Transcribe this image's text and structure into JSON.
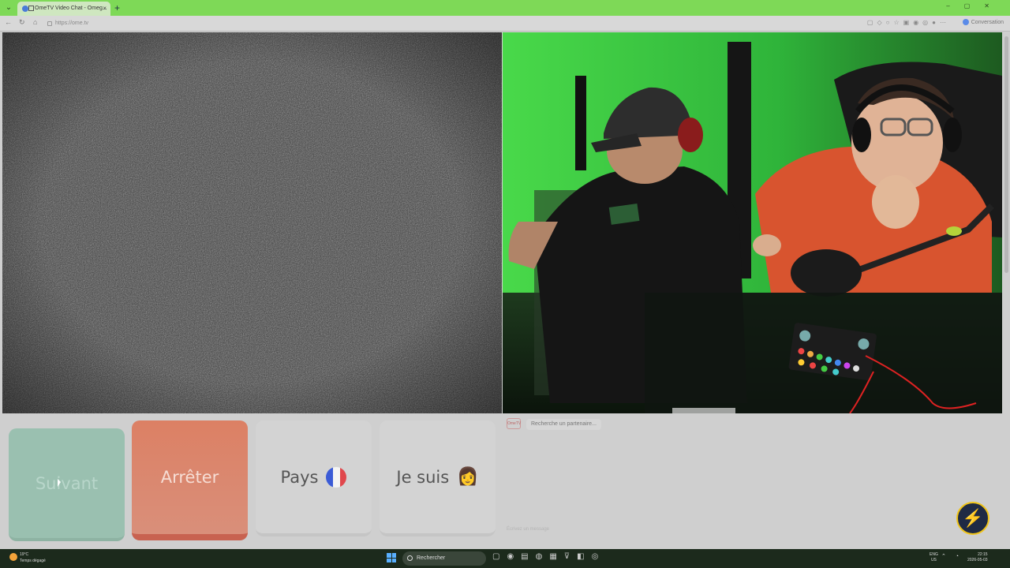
{
  "browser": {
    "tab_title": "OmeTV Video Chat - Omeg...",
    "new_tab": "+",
    "url": "https://ome.tv",
    "profile_label": "Conversation"
  },
  "controls": {
    "next_label": "Suivant",
    "stop_label": "Arrêter",
    "country_label": "Pays",
    "iam_label": "Je suis",
    "iam_emoji": "👩"
  },
  "chat": {
    "logo_text": "OmeTV",
    "status": "Recherche un partenaire...",
    "input_placeholder": "Écrivez un message"
  },
  "taskbar": {
    "temperature": "19°C",
    "weather_text": "Temps dégagé",
    "search_placeholder": "Rechercher",
    "lang_top": "ENG",
    "lang_bottom": "US",
    "time": "22:15",
    "date": "2026-05-03"
  },
  "colors": {
    "tabbar": "#7ed957",
    "stop_button": "#dc8064",
    "next_button": "#9ac0b0",
    "bolt": "#f0c419"
  }
}
